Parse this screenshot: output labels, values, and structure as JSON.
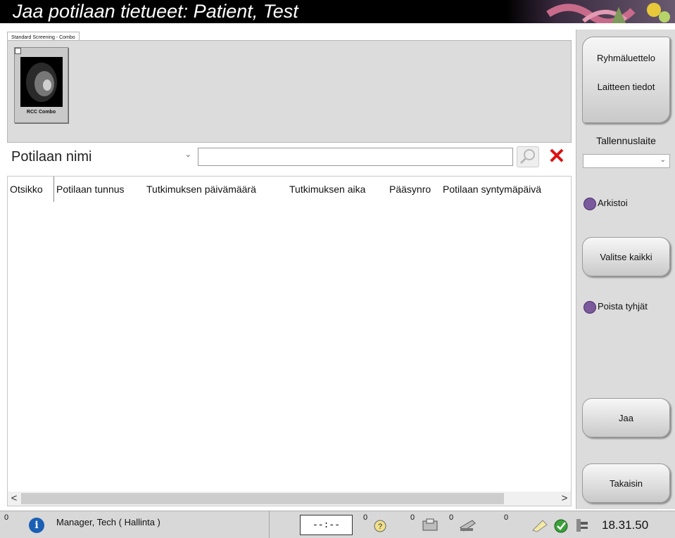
{
  "window": {
    "title": "Jaa potilaan tietueet: Patient, Test"
  },
  "procedure_tab": {
    "label": "Standard Screening - Combo"
  },
  "thumbnail": {
    "label": "RCC Combo"
  },
  "search": {
    "field_selected": "Potilaan nimi",
    "value": ""
  },
  "table": {
    "columns": [
      "Otsikko",
      "Potilaan tunnus",
      "Tutkimuksen päivämäärä",
      "Tutkimuksen aika",
      "Pääsynro",
      "Potilaan syntymäpäivä"
    ],
    "rows": []
  },
  "right_panel": {
    "group_list_button": "Ryhmäluettelo",
    "device_info_button": "Laitteen tiedot",
    "storage_device_label": "Tallennuslaite",
    "storage_device_value": "",
    "archive_option": "Arkistoi",
    "select_all_button": "Valitse kaikki",
    "remove_empty_option": "Poista tyhjät",
    "share_button": "Jaa",
    "back_button": "Takaisin"
  },
  "status": {
    "alert_count": "0",
    "user": "Manager, Tech ( Hallinta )",
    "timer": "--:--",
    "queue_count_1": "0",
    "queue_count_2": "0",
    "queue_count_3": "0",
    "queue_count_4": "0",
    "time": "18.31.50"
  },
  "colors": {
    "titlebar": "#000000",
    "delete": "#d11111",
    "radio": "#7a5a9c",
    "info": "#1a5fb4"
  }
}
